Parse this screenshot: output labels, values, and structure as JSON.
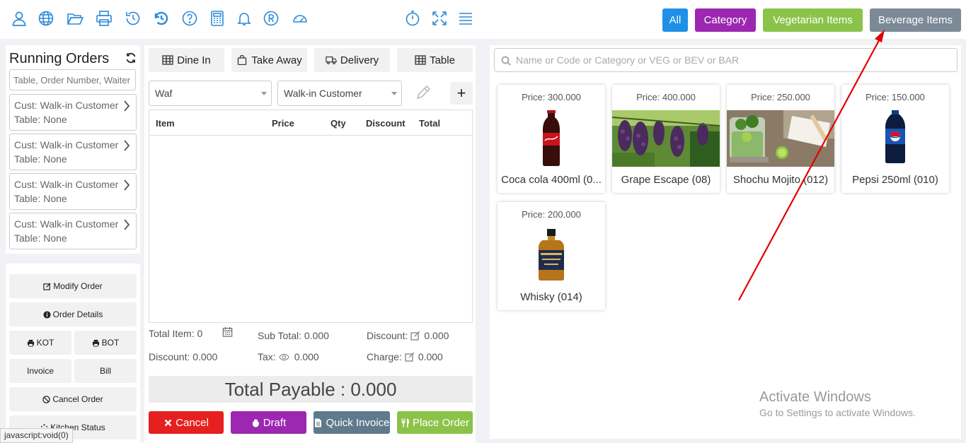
{
  "toolbar": {
    "icons": [
      "user-icon",
      "globe-icon",
      "folder-open-icon",
      "printer-icon",
      "history-icon",
      "undo-history-icon",
      "help-icon",
      "calculator-icon",
      "bell-icon",
      "registered-icon",
      "dashboard-gauge-icon",
      "stopwatch-icon",
      "fullscreen-icon",
      "menu-icon"
    ]
  },
  "categories": {
    "all": "All",
    "category": "Category",
    "vegetarian": "Vegetarian Items",
    "beverage": "Beverage Items",
    "colors": {
      "all": "#1e90e8",
      "category": "#9c27b0",
      "vegetarian": "#8bc34a",
      "beverage": "#7b8a96"
    }
  },
  "running_orders": {
    "title": "Running Orders",
    "search_placeholder": "Table, Order Number, Waiter",
    "orders": [
      {
        "customer": "Cust: Walk-in Customer",
        "table": "Table: None"
      },
      {
        "customer": "Cust: Walk-in Customer",
        "table": "Table: None"
      },
      {
        "customer": "Cust: Walk-in Customer",
        "table": "Table: None"
      },
      {
        "customer": "Cust: Walk-in Customer",
        "table": "Table: None"
      }
    ],
    "actions": {
      "modify": "Modify Order",
      "details": "Order Details",
      "kot": "KOT",
      "bot": "BOT",
      "invoice": "Invoice",
      "bill": "Bill",
      "cancel": "Cancel Order",
      "kitchen": "Kitchen Status"
    }
  },
  "order_panel": {
    "types": {
      "dine_in": "Dine In",
      "take_away": "Take Away",
      "delivery": "Delivery",
      "table": "Table"
    },
    "waiter": "Waf",
    "customer": "Walk-in Customer",
    "columns": {
      "item": "Item",
      "price": "Price",
      "qty": "Qty",
      "discount": "Discount",
      "total": "Total"
    },
    "summary": {
      "total_item": "Total Item: 0",
      "sub_total": "Sub Total: 0.000",
      "discount_label": "Discount:",
      "discount_value": "0.000",
      "discount2": "Discount: 0.000",
      "tax_label": "Tax:",
      "tax_value": "0.000",
      "charge_label": "Charge:",
      "charge_value": "0.000"
    },
    "total_payable": "Total Payable : 0.000",
    "buttons": {
      "cancel": "Cancel",
      "draft": "Draft",
      "quick_invoice": "Quick Invoice",
      "place_order": "Place Order"
    },
    "button_colors": {
      "cancel": "#e62020",
      "draft": "#9c27b0",
      "quick_invoice": "#5e7a8c",
      "place_order": "#8bc34a"
    }
  },
  "products": {
    "search_placeholder": "Name or Code or Category or VEG or BEV or BAR",
    "items": [
      {
        "price": "Price: 300.000",
        "name": "Coca cola 400ml (0..."
      },
      {
        "price": "Price: 400.000",
        "name": "Grape Escape (08)"
      },
      {
        "price": "Price: 250.000",
        "name": "Shochu Mojito (012)"
      },
      {
        "price": "Price: 150.000",
        "name": "Pepsi 250ml (010)"
      },
      {
        "price": "Price: 200.000",
        "name": "Whisky (014)"
      }
    ]
  },
  "watermark": {
    "title": "Activate Windows",
    "subtitle": "Go to Settings to activate Windows."
  },
  "status_bar": "javascript:void(0)"
}
